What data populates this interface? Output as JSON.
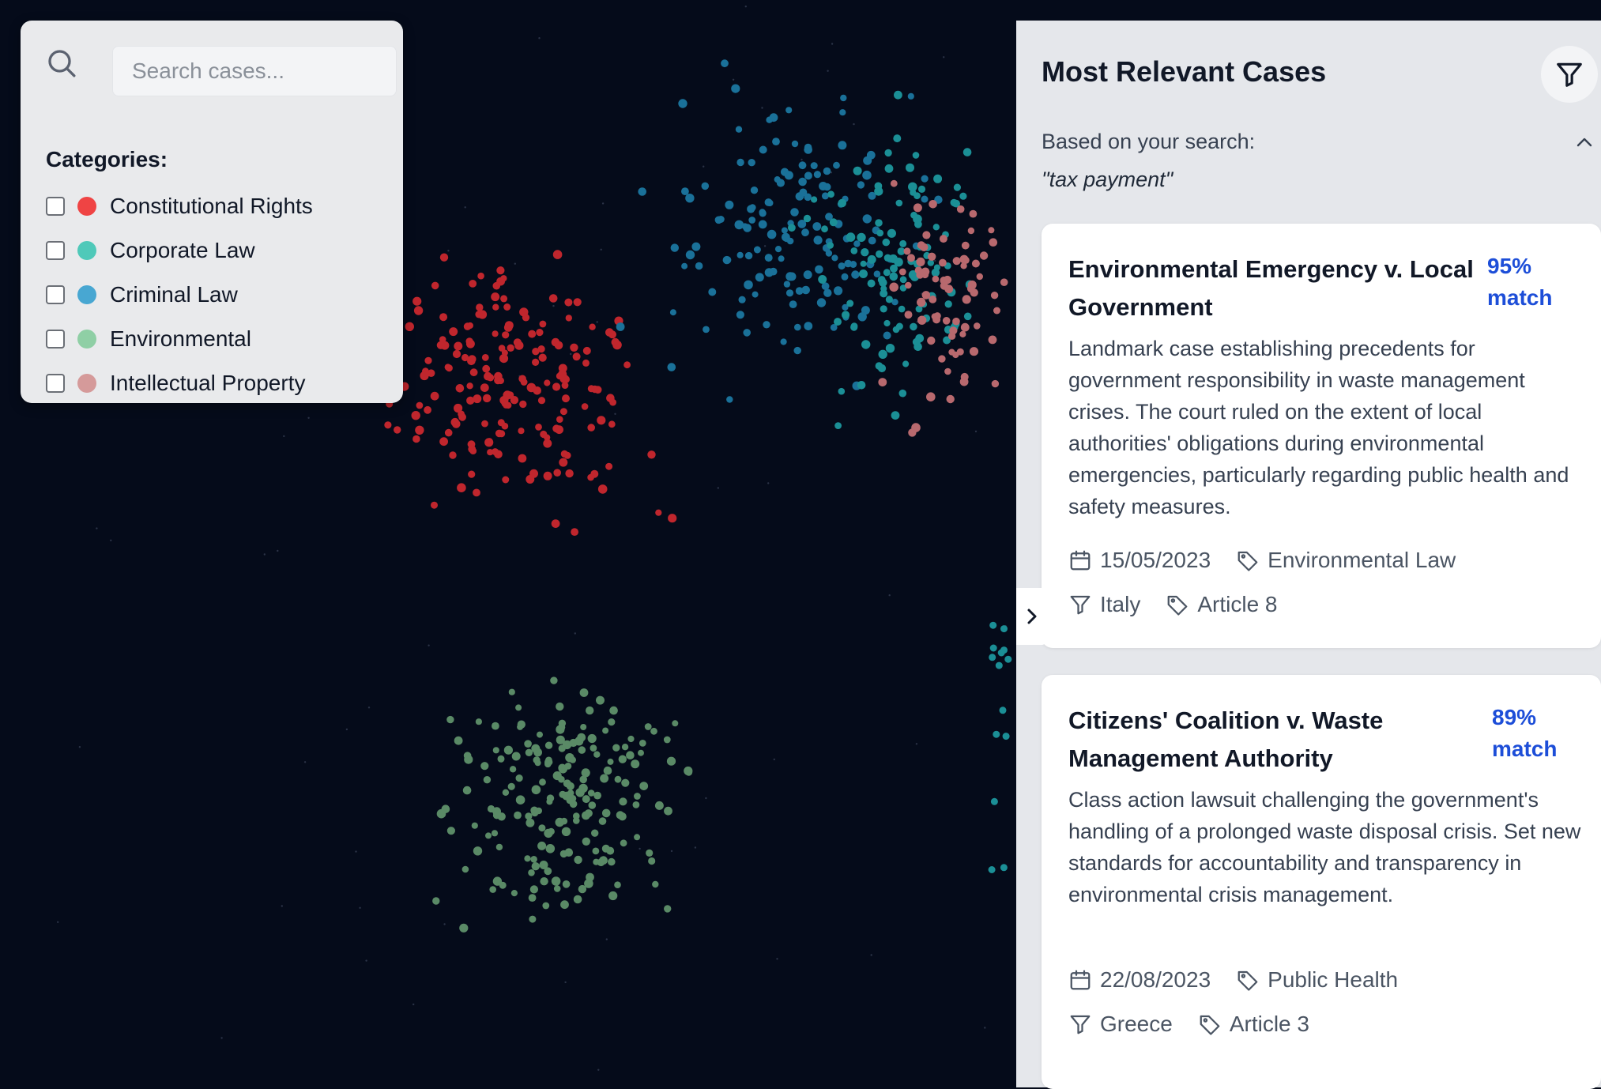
{
  "search": {
    "placeholder": "Search cases..."
  },
  "filters": {
    "title": "Categories:",
    "categories": [
      {
        "label": "Constitutional Rights",
        "color": "#ef4444"
      },
      {
        "label": "Corporate Law",
        "color": "#4fc9b9"
      },
      {
        "label": "Criminal Law",
        "color": "#48a7d2"
      },
      {
        "label": "Environmental",
        "color": "#8fcfa5"
      },
      {
        "label": "Intellectual Property",
        "color": "#d59a9a"
      }
    ]
  },
  "panel": {
    "title": "Most Relevant Cases",
    "based_on_label": "Based on your search:",
    "query": "\"tax payment\""
  },
  "cases": [
    {
      "title": "Environmental Emergency v. Local Government",
      "match": "95% match",
      "description": "Landmark case establishing precedents for government responsibility in waste management crises. The court ruled on the extent of local authorities' obligations during environmental emergencies, particularly regarding public health and safety measures.",
      "date": "15/05/2023",
      "tag": "Environmental Law",
      "country": "Italy",
      "article": "Article 8"
    },
    {
      "title": "Citizens' Coalition v. Waste Management Authority",
      "match": "89% match",
      "description": "Class action lawsuit challenging the government's handling of a prolonged waste disposal crisis. Set new standards for accountability and transparency in environmental crisis management.",
      "date": "22/08/2023",
      "tag": "Public Health",
      "country": "Greece",
      "article": "Article 3"
    }
  ],
  "colors": {
    "background": "#050b1a",
    "constitutional": "#c0262d",
    "corporate": "#1b8f96",
    "criminal": "#1a7199",
    "environmental": "#5a8a66",
    "intellectual": "#b8696e",
    "accent": "#1d4ed8"
  },
  "icons": {
    "search": "search-icon",
    "filter": "filter-icon",
    "calendar": "calendar-icon",
    "tag": "tag-icon",
    "chevron_up": "chevron-up-icon",
    "chevron_right": "chevron-right-icon"
  }
}
